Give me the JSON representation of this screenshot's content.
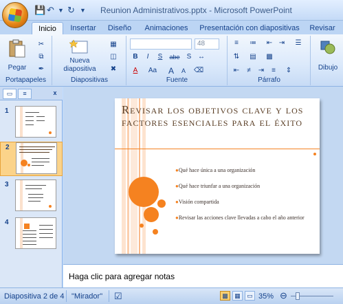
{
  "window": {
    "title": "Reunion Administrativos.pptx - Microsoft PowerPoint"
  },
  "tabs": [
    {
      "label": "Inicio"
    },
    {
      "label": "Insertar"
    },
    {
      "label": "Diseño"
    },
    {
      "label": "Animaciones"
    },
    {
      "label": "Presentación con diapositivas"
    },
    {
      "label": "Revisar"
    }
  ],
  "ribbon": {
    "clipboard": {
      "paste_label": "Pegar",
      "group_label": "Portapapeles"
    },
    "slides": {
      "new_slide_label": "Nueva\ndiapositiva",
      "group_label": "Diapositivas"
    },
    "font": {
      "font_name": "",
      "font_size": "48",
      "group_label": "Fuente",
      "bold": "B",
      "italic": "I",
      "underline": "S",
      "strike": "abe",
      "shadow": "S",
      "font_color": "A",
      "case": "Aa",
      "grow": "A",
      "shrink": "A"
    },
    "paragraph": {
      "group_label": "Párrafo"
    },
    "drawing": {
      "label": "Dibujo"
    }
  },
  "slide_panel": {
    "thumbnails": [
      {
        "number": "1"
      },
      {
        "number": "2"
      },
      {
        "number": "3"
      },
      {
        "number": "4"
      }
    ]
  },
  "slide": {
    "title": "Revisar los objetivos clave y los factores esenciales para el éxito",
    "bullets": [
      "Qué hace única a una organización",
      "Qué hace triunfar a una organización",
      "Visión compartida",
      "Revisar las acciones clave llevadas a cabo el año anterior"
    ],
    "accent_color": "#f58220"
  },
  "notes": {
    "placeholder": "Haga clic para agregar notas"
  },
  "status": {
    "slide_info": "Diapositiva 2 de 4",
    "theme": "\"Mirador\"",
    "zoom": "35%"
  }
}
